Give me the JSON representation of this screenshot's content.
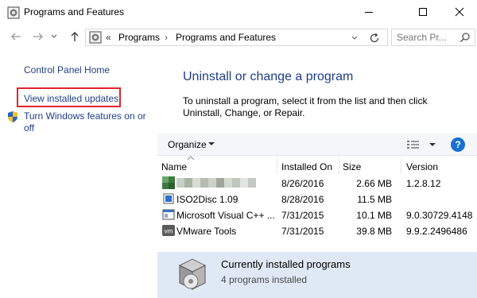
{
  "window": {
    "title": "Programs and Features",
    "controls": {
      "minimize": "minimize-icon",
      "maximize": "maximize-icon",
      "close": "close-icon"
    }
  },
  "address": {
    "chevron": "«",
    "crumbs": [
      "Programs",
      "Programs and Features"
    ],
    "separator": "›",
    "search_placeholder": "Search Pr..."
  },
  "sidebar": {
    "home": "Control Panel Home",
    "updates": "View installed updates",
    "features": "Turn Windows features on or off"
  },
  "main": {
    "title": "Uninstall or change a program",
    "description": "To uninstall a program, select it from the list and then click Uninstall, Change, or Repair."
  },
  "toolbar": {
    "organize": "Organize",
    "help": "?"
  },
  "columns": {
    "name": "Name",
    "installed_on": "Installed On",
    "size": "Size",
    "version": "Version"
  },
  "programs": [
    {
      "name": "",
      "installed_on": "8/26/2016",
      "size": "2.66 MB",
      "version": "1.2.8.12",
      "icon": "blurred-app-icon"
    },
    {
      "name": "ISO2Disc 1.09",
      "installed_on": "8/28/2016",
      "size": "11.5 MB",
      "version": "",
      "icon": "iso2disc-icon"
    },
    {
      "name": "Microsoft Visual C++ ...",
      "installed_on": "7/31/2015",
      "size": "10.1 MB",
      "version": "9.0.30729.4148",
      "icon": "visual-cpp-icon"
    },
    {
      "name": "VMware Tools",
      "installed_on": "7/31/2015",
      "size": "39.8 MB",
      "version": "9.9.2.2496486",
      "icon": "vmware-icon"
    }
  ],
  "status": {
    "title": "Currently installed programs",
    "count": "4 programs installed"
  },
  "colors": {
    "link": "#1e3e8a",
    "highlight_border": "#e0252d",
    "status_bg": "#dfe9f5",
    "help_blue": "#1a6fd1"
  }
}
